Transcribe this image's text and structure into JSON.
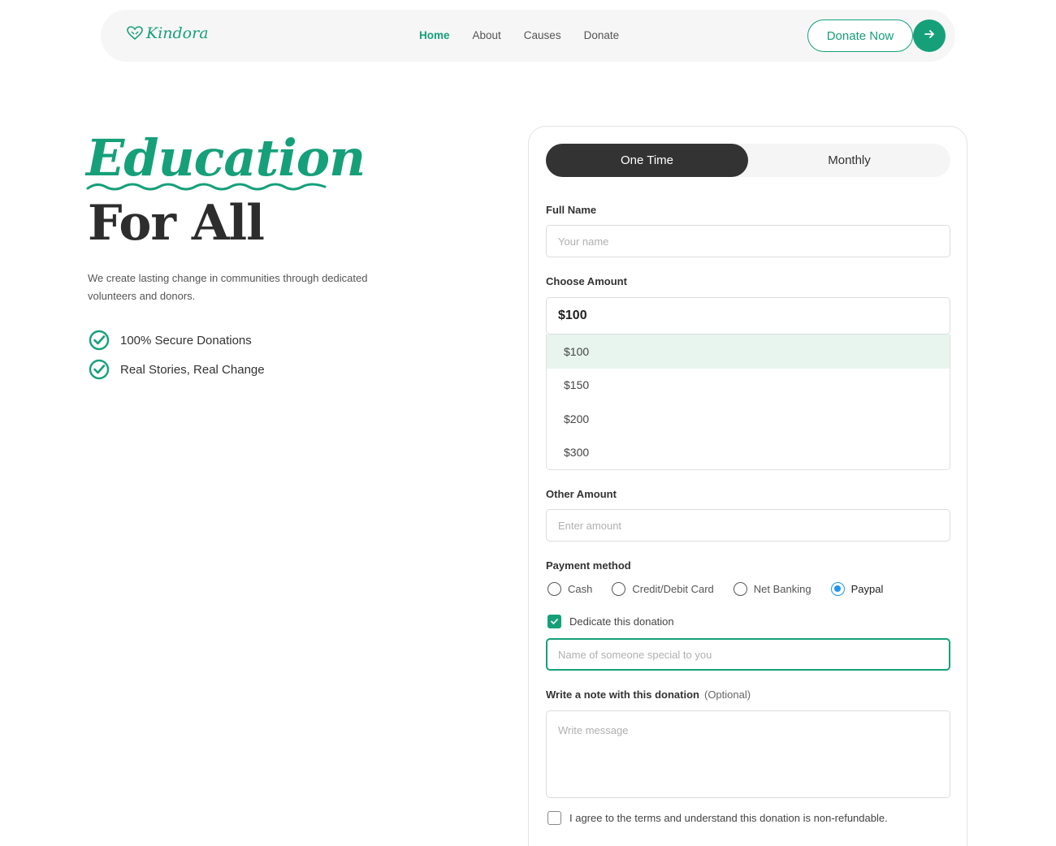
{
  "nav": {
    "logo": "Kindora",
    "links": [
      "Home",
      "About",
      "Causes",
      "Donate"
    ],
    "active": "Home",
    "donate_label": "Donate Now"
  },
  "hero": {
    "title_line1": "Education",
    "title_line2": "For All",
    "description": "We create lasting change in communities through dedicated volunteers and donors.",
    "features": [
      "100% Secure Donations",
      "Real Stories, Real Change"
    ]
  },
  "form": {
    "toggle": {
      "one_time": "One Time",
      "monthly": "Monthly",
      "selected": "One Time"
    },
    "full_name": {
      "label": "Full Name",
      "placeholder": "Your name",
      "value": ""
    },
    "amount": {
      "label": "Choose Amount",
      "selected": "$100",
      "options": [
        "$100",
        "$150",
        "$200",
        "$300"
      ]
    },
    "other_amount": {
      "label": "Other Amount",
      "placeholder": "Enter amount"
    },
    "payment": {
      "label": "Payment method",
      "options": [
        "Cash",
        "Credit/Debit Card",
        "Net Banking",
        "Paypal"
      ],
      "selected": "Paypal"
    },
    "dedicate": {
      "label": "Dedicate this donation",
      "checked": true,
      "placeholder": "Name of someone special to you"
    },
    "note": {
      "label": "Write a note with this donation",
      "optional": "(Optional)",
      "placeholder": "Write message"
    },
    "terms": {
      "label": "I agree to the terms and understand this donation is non-refundable.",
      "checked": false
    }
  },
  "colors": {
    "accent": "#16a07a",
    "dark": "#333333",
    "radio_selected": "#2196f3",
    "dropdown_highlight": "#e8f5ef"
  }
}
